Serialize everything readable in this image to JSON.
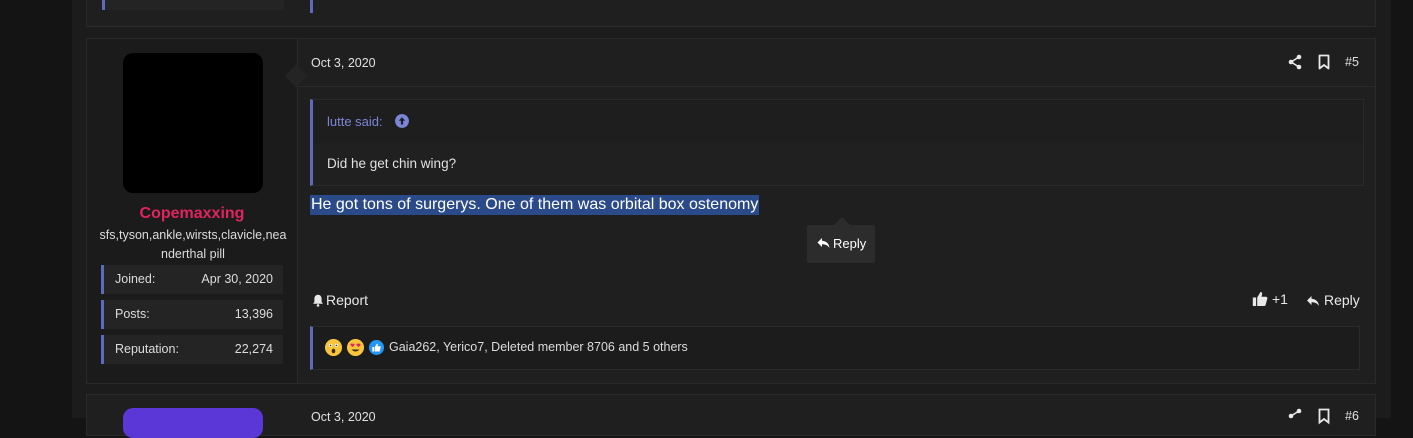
{
  "post": {
    "date": "Oct 3, 2020",
    "number": "#5",
    "user": {
      "name": "Copemaxxing",
      "title": "sfs,tyson,ankle,wirsts,clavicle,neanderthal pill",
      "stats": [
        {
          "key": "Joined:",
          "value": "Apr 30, 2020"
        },
        {
          "key": "Posts:",
          "value": "13,396"
        },
        {
          "key": "Reputation:",
          "value": "22,274"
        }
      ]
    },
    "quote": {
      "author": "lutte said:",
      "text": "Did he get chin wing?"
    },
    "message": "He got tons of surgerys. One of them was orbital box ostenomy",
    "selection_reply_label": "Reply",
    "actions": {
      "report": "Report",
      "react": "+1",
      "reply": "Reply"
    },
    "reactions": {
      "icons": [
        "shocked-emoji",
        "heart-eyes-emoji",
        "like-emoji"
      ],
      "names": "Gaia262, Yerico7, Deleted member 8706 and 5 others"
    }
  },
  "next_post": {
    "date": "Oct 3, 2020",
    "number": "#6"
  },
  "colors": {
    "accent": "#5c6bc0",
    "username": "#e0245e",
    "selection": "#2b4a8a",
    "quote_author": "#7b86d6"
  }
}
